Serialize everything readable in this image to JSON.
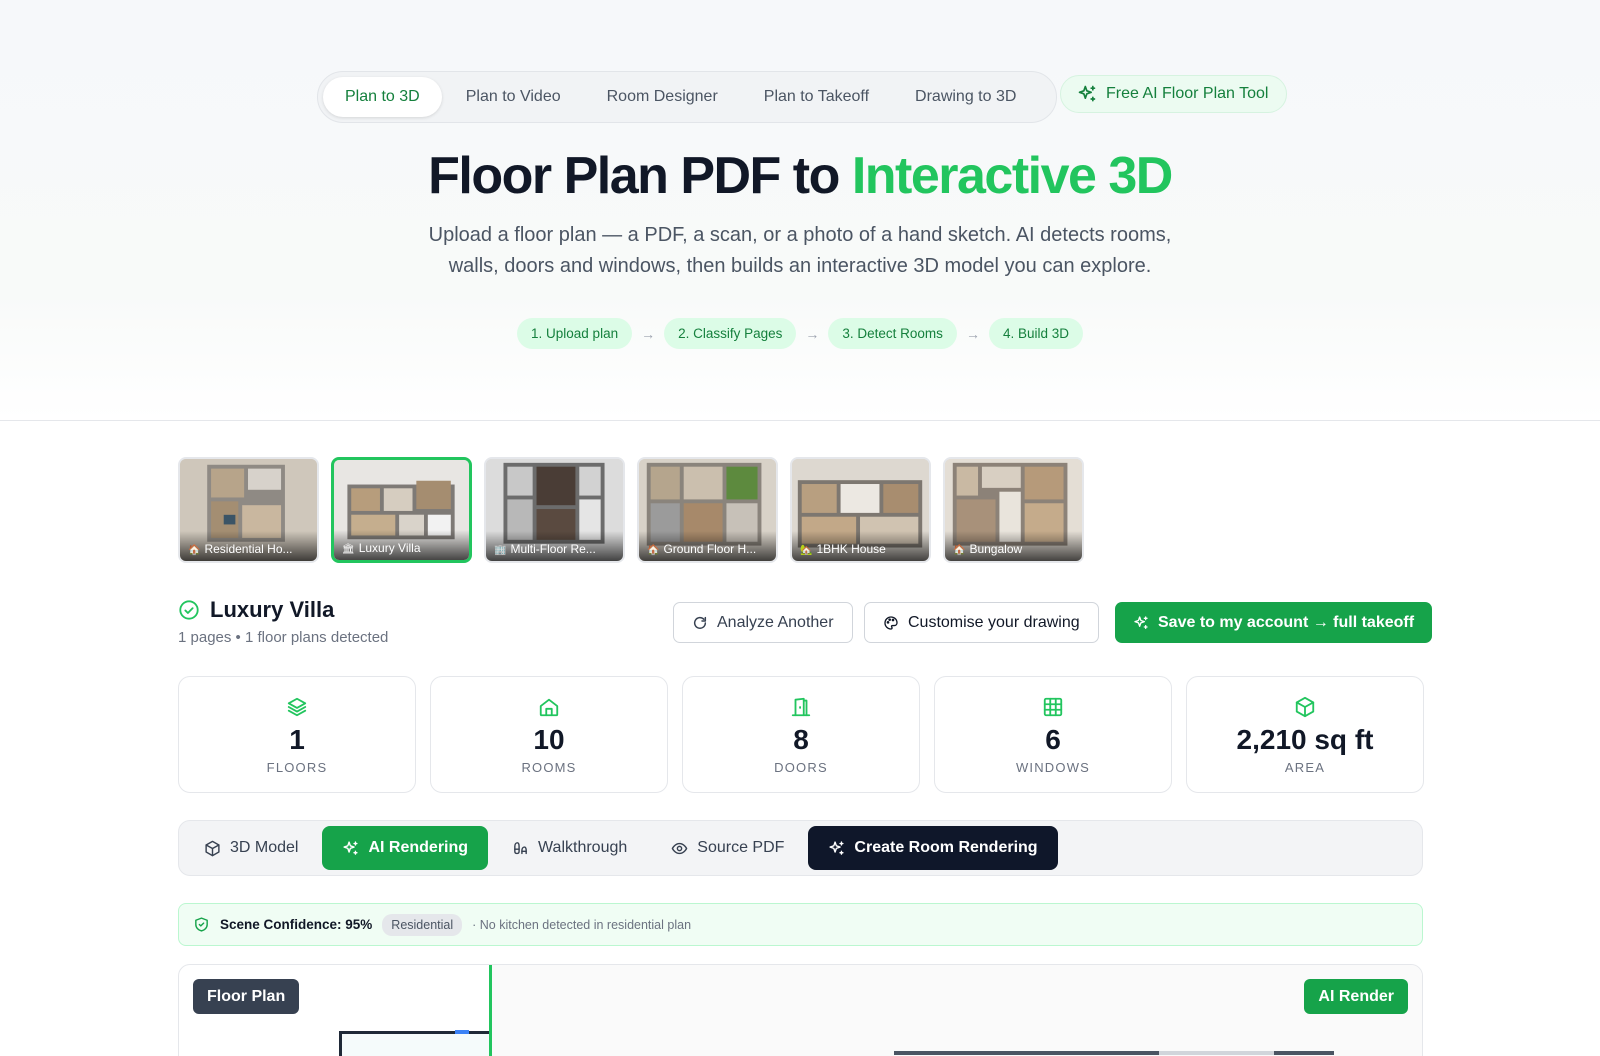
{
  "nav": {
    "tabs": [
      {
        "label": "Plan to 3D",
        "active": true
      },
      {
        "label": "Plan to Video",
        "active": false
      },
      {
        "label": "Room Designer",
        "active": false
      },
      {
        "label": "Plan to Takeoff",
        "active": false
      },
      {
        "label": "Drawing to 3D",
        "active": false
      }
    ],
    "free_tool_label": "Free AI Floor Plan Tool"
  },
  "hero": {
    "title_main": "Floor Plan PDF to ",
    "title_accent": "Interactive 3D",
    "subtitle": "Upload a floor plan — a PDF, a scan, or a photo of a hand sketch. AI detects rooms, walls, doors and windows, then builds an interactive 3D model you can explore.",
    "steps": [
      "1. Upload plan",
      "2. Classify Pages",
      "3. Detect Rooms",
      "4. Build 3D"
    ]
  },
  "samples": [
    {
      "label": "Residential Ho...",
      "icon": "house-icon",
      "active": false
    },
    {
      "label": "Luxury Villa",
      "icon": "building-icon",
      "active": true
    },
    {
      "label": "Multi-Floor Re...",
      "icon": "building-icon",
      "active": false
    },
    {
      "label": "Ground Floor H...",
      "icon": "house-icon",
      "active": false
    },
    {
      "label": "1BHK House",
      "icon": "house-icon",
      "active": false
    },
    {
      "label": "Bungalow",
      "icon": "house-icon",
      "active": false
    }
  ],
  "project": {
    "name": "Luxury Villa",
    "meta": "1 pages • 1 floor plans detected",
    "analyze_label": "Analyze Another",
    "customise_label": "Customise your drawing",
    "save_label": "Save to my account → full takeoff"
  },
  "stats": [
    {
      "value": "1",
      "label": "FLOORS",
      "icon": "layers-icon"
    },
    {
      "value": "10",
      "label": "ROOMS",
      "icon": "home-icon"
    },
    {
      "value": "8",
      "label": "DOORS",
      "icon": "door-icon"
    },
    {
      "value": "6",
      "label": "WINDOWS",
      "icon": "window-grid-icon"
    },
    {
      "value": "2,210 sq ft",
      "label": "AREA",
      "icon": "cube-icon"
    }
  ],
  "views": {
    "tabs": [
      {
        "label": "3D Model",
        "icon": "cube-icon",
        "state": "normal"
      },
      {
        "label": "AI Rendering",
        "icon": "sparkles-icon",
        "state": "active"
      },
      {
        "label": "Walkthrough",
        "icon": "footprints-icon",
        "state": "normal"
      },
      {
        "label": "Source PDF",
        "icon": "eye-icon",
        "state": "normal"
      },
      {
        "label": "Create Room Rendering",
        "icon": "sparkles-icon",
        "state": "dark"
      }
    ]
  },
  "confidence": {
    "title": "Scene Confidence: 95%",
    "badge": "Residential",
    "note": "· No kitchen detected in residential plan"
  },
  "compare": {
    "left_label": "Floor Plan",
    "right_label": "AI Render"
  },
  "colors": {
    "accent": "#22c55e",
    "primary_button": "#16a34a",
    "dark_button": "#0f172a"
  }
}
